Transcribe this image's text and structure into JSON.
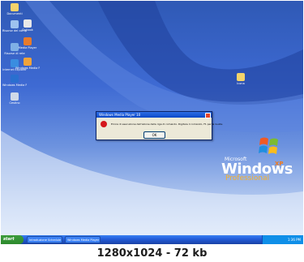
{
  "desktop": {
    "icons_left": [
      {
        "label": "Documenti"
      },
      {
        "label": "Risorse del computer"
      },
      {
        "label": "Risorse di rete"
      },
      {
        "label": "Internet Explorer"
      },
      {
        "label": "Windows Media Player"
      },
      {
        "label": "Cestino"
      }
    ],
    "icons_second_col": [
      {
        "label": "Outlook"
      },
      {
        "label": "Media Player"
      },
      {
        "label": "Windows Media Player"
      }
    ],
    "icon_right": {
      "label": "Icona"
    },
    "logo": {
      "microsoft": "Microsoft",
      "windows": "Windows",
      "xp": "XP",
      "edition": "Professional"
    }
  },
  "dialog": {
    "title": "Windows Media Player 10",
    "message": "Errore di esecuzione dell'azione della riga di comando. Digitare il comando, F1 per la Guida.",
    "ok_label": "OK"
  },
  "taskbar": {
    "start_label": "start",
    "tasks": [
      "Introduzione Schedule",
      "Windows Media Player"
    ],
    "clock": "1:36 PM"
  },
  "caption": "1280x1024 - 72 kb",
  "colors": {
    "accent": "#245edb",
    "error": "#d4161b",
    "start_green": "#3c9c3c"
  }
}
